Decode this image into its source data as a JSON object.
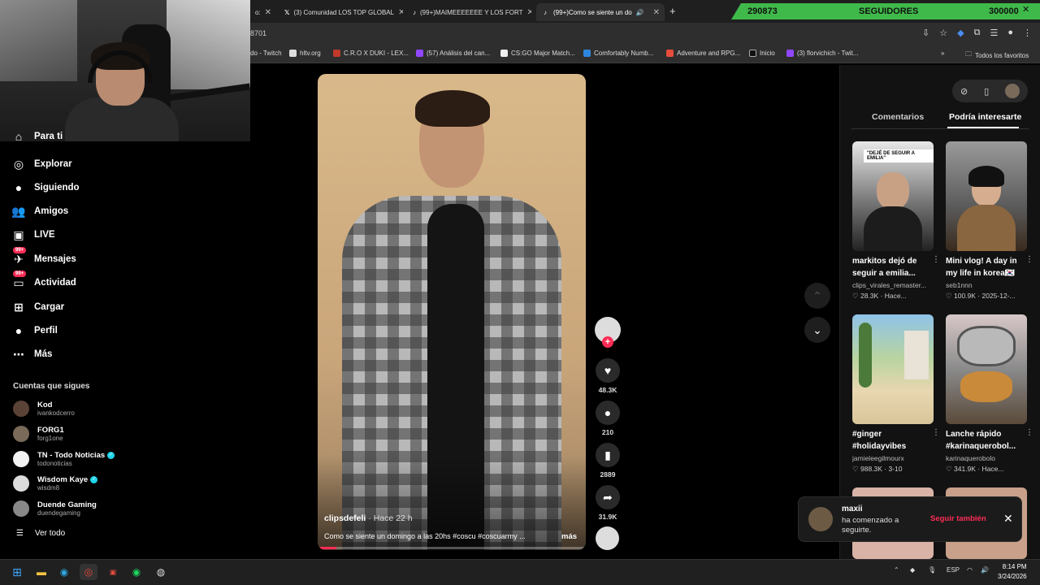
{
  "browser": {
    "tabs": [
      {
        "label": "o:",
        "active": false
      },
      {
        "label": "(3) Comunidad LOS TOP GLOBAL",
        "active": false
      },
      {
        "label": "(99+)MAIMEEEEEEE Y LOS FORT",
        "active": false
      },
      {
        "label": "(99+)Como se siente un do",
        "active": true
      }
    ],
    "url": "8701",
    "bookmarks": [
      "do - Twitch",
      "hltv.org",
      "C.R.O X DUKI - LEX...",
      "(57) Análisis del can...",
      "CS:GO Major Match...",
      "Comfortably Numb...",
      "Adventure and RPG...",
      "Inicio",
      "(3) florvichich - Twit..."
    ],
    "all_bookmarks": "Todos los favoritos"
  },
  "follower_goal": {
    "current": "290873",
    "label": "SEGUIDORES",
    "goal": "300000",
    "color": "#3fb94a"
  },
  "sidebar": {
    "partial_item": "Para ti",
    "items": [
      {
        "label": "Explorar",
        "icon": "compass-icon",
        "glyph": "◎"
      },
      {
        "label": "Siguiendo",
        "icon": "avatar-icon",
        "glyph": "●"
      },
      {
        "label": "Amigos",
        "icon": "friends-icon",
        "glyph": "👥"
      },
      {
        "label": "LIVE",
        "icon": "live-icon",
        "glyph": "▣"
      },
      {
        "label": "Mensajes",
        "icon": "messages-icon",
        "glyph": "✈",
        "badge": "99+"
      },
      {
        "label": "Actividad",
        "icon": "activity-icon",
        "glyph": "▭",
        "badge": "99+"
      },
      {
        "label": "Cargar",
        "icon": "upload-icon",
        "glyph": "⊞"
      },
      {
        "label": "Perfil",
        "icon": "profile-icon",
        "glyph": "●"
      },
      {
        "label": "Más",
        "icon": "more-icon",
        "glyph": "⋯"
      }
    ],
    "following_header": "Cuentas que sigues",
    "accounts": [
      {
        "name": "Kod",
        "handle": "ivankodcerro",
        "verified": false,
        "color": "#5a4336"
      },
      {
        "name": "FORG1",
        "handle": "forg1one",
        "verified": false,
        "color": "#7a6a5a"
      },
      {
        "name": "TN - Todo Noticias",
        "handle": "todonoticias",
        "verified": true,
        "color": "#f2f2f2"
      },
      {
        "name": "Wisdom Kaye",
        "handle": "wisdm8",
        "verified": true,
        "color": "#dcdcdc"
      },
      {
        "name": "Duende Gaming",
        "handle": "duendegaming",
        "verified": false,
        "color": "#888"
      }
    ],
    "see_all": "Ver todo"
  },
  "video": {
    "author": "clipsdefeli",
    "time": "· Hace 22 h",
    "description": "Como se siente un domingo a las 20hs #coscu #coscuarmy ...",
    "more": "más",
    "progress": 0.07
  },
  "actions": {
    "likes": "48.3K",
    "comments": "210",
    "saves": "2889",
    "shares": "31.9K"
  },
  "right_panel": {
    "tab_comments": "Comentarios",
    "tab_suggested": "Podría interesarte",
    "cards": [
      {
        "title": "markitos dejó de seguir a emilia...",
        "user": "clips_virales_remaster...",
        "likes": "28.3K",
        "date": "Hace...",
        "label": "\"DEJÉ DE SEGUIR A EMILIA\""
      },
      {
        "title": "Mini vlog! A day in my life in korea🇰🇷",
        "user": "seb1nnn",
        "likes": "100.9K",
        "date": "2025-12-...",
        "label": ""
      },
      {
        "title": "#ginger #holidayvibes",
        "user": "jamieleegilmourx",
        "likes": "988.3K",
        "date": "3-10",
        "label": ""
      },
      {
        "title": "Lanche rápido #karinaquerobol...",
        "user": "karinaquerobolo",
        "likes": "341.9K",
        "date": "Hace...",
        "label": ""
      }
    ]
  },
  "toast": {
    "name": "maxii",
    "message": "ha comenzado a seguirte.",
    "button": "Seguir también"
  },
  "taskbar": {
    "lang": "ESP",
    "time": "8:14 PM",
    "date": "3/24/2026"
  }
}
